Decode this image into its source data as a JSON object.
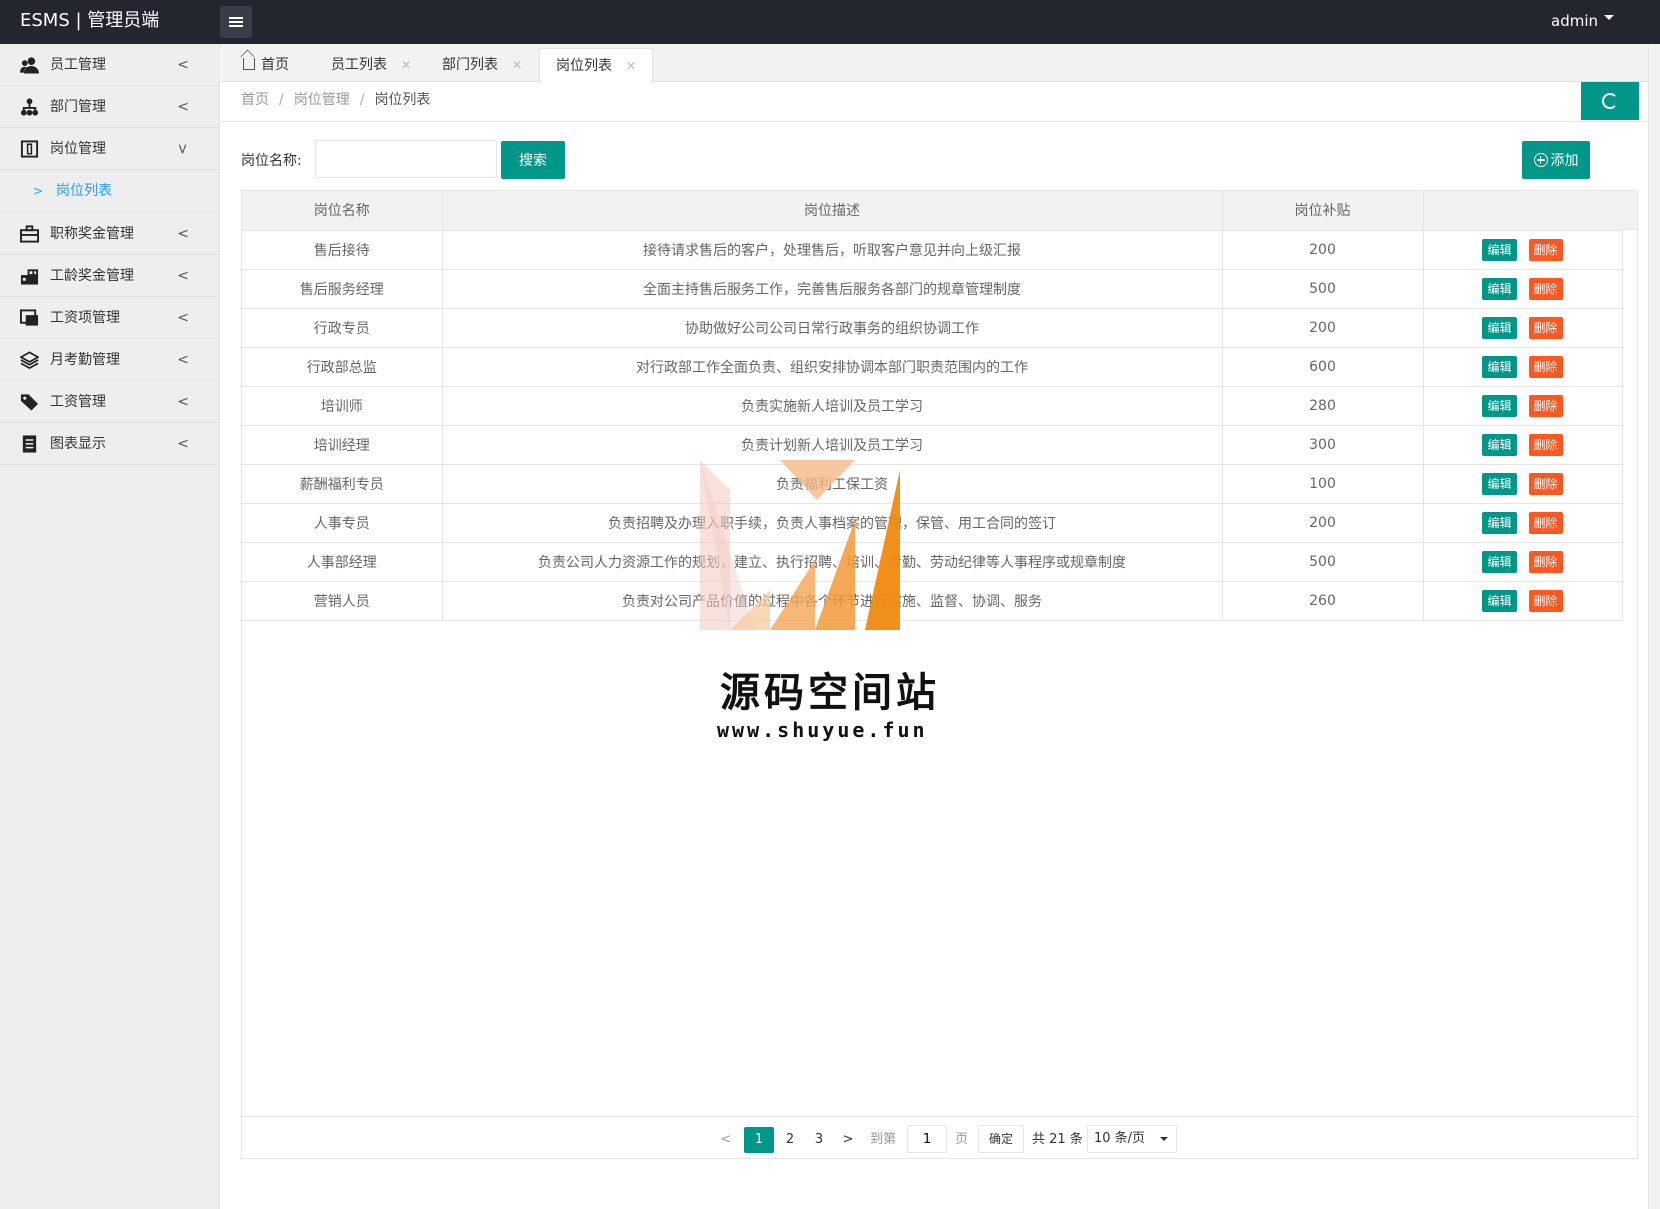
{
  "header": {
    "logo": "ESMS | 管理员端",
    "user": "admin"
  },
  "sidebar": {
    "items": [
      {
        "label": "员工管理",
        "icon": "users-icon"
      },
      {
        "label": "部门管理",
        "icon": "sitemap-icon"
      },
      {
        "label": "岗位管理",
        "icon": "badge-icon"
      },
      {
        "label": "职称奖金管理",
        "icon": "briefcase-icon"
      },
      {
        "label": "工龄奖金管理",
        "icon": "building-icon"
      },
      {
        "label": "工资项管理",
        "icon": "window-icon"
      },
      {
        "label": "月考勤管理",
        "icon": "layers-icon"
      },
      {
        "label": "工资管理",
        "icon": "tag-icon"
      },
      {
        "label": "图表显示",
        "icon": "document-icon"
      }
    ],
    "sub_item": "岗位列表"
  },
  "tabs": [
    {
      "label": "首页"
    },
    {
      "label": "员工列表"
    },
    {
      "label": "部门列表"
    },
    {
      "label": "岗位列表"
    }
  ],
  "breadcrumb": [
    "首页",
    "岗位管理",
    "岗位列表"
  ],
  "breadcrumb_sep": "/",
  "search": {
    "label": "岗位名称:",
    "value": "",
    "placeholder": "",
    "button": "搜索"
  },
  "add_button": "添加",
  "table": {
    "headers": [
      "岗位名称",
      "岗位描述",
      "岗位补贴",
      ""
    ],
    "edit_label": "编辑",
    "delete_label": "删除",
    "rows": [
      {
        "name": "售后接待",
        "desc": "接待请求售后的客户，处理售后，听取客户意见并向上级汇报",
        "allowance": "200"
      },
      {
        "name": "售后服务经理",
        "desc": "全面主持售后服务工作，完善售后服务各部门的规章管理制度",
        "allowance": "500"
      },
      {
        "name": "行政专员",
        "desc": "协助做好公司公司日常行政事务的组织协调工作",
        "allowance": "200"
      },
      {
        "name": "行政部总监",
        "desc": "对行政部工作全面负责、组织安排协调本部门职责范围内的工作",
        "allowance": "600"
      },
      {
        "name": "培训师",
        "desc": "负责实施新人培训及员工学习",
        "allowance": "280"
      },
      {
        "name": "培训经理",
        "desc": "负责计划新人培训及员工学习",
        "allowance": "300"
      },
      {
        "name": "薪酬福利专员",
        "desc": "负责福利工保工资",
        "allowance": "100"
      },
      {
        "name": "人事专员",
        "desc": "负责招聘及办理入职手续，负责人事档案的管理，保管、用工合同的签订",
        "allowance": "200"
      },
      {
        "name": "人事部经理",
        "desc": "负责公司人力资源工作的规划，建立、执行招聘、培训、考勤、劳动纪律等人事程序或规章制度",
        "allowance": "500"
      },
      {
        "name": "营销人员",
        "desc": "负责对公司产品价值的过程中各个环节进行实施、监督、协调、服务",
        "allowance": "260"
      }
    ]
  },
  "pager": {
    "pages": [
      "1",
      "2",
      "3"
    ],
    "current": "1",
    "goto_label": "到第",
    "goto_value": "1",
    "page_unit": "页",
    "ok": "确定",
    "total": "共 21 条",
    "per_page": "10 条/页"
  },
  "watermark": {
    "title": "源码空间站",
    "url": "www.shuyue.fun"
  },
  "colors": {
    "primary": "#009688",
    "danger": "#ff5722",
    "link": "#1e9fff",
    "header_bg": "#23262e"
  }
}
